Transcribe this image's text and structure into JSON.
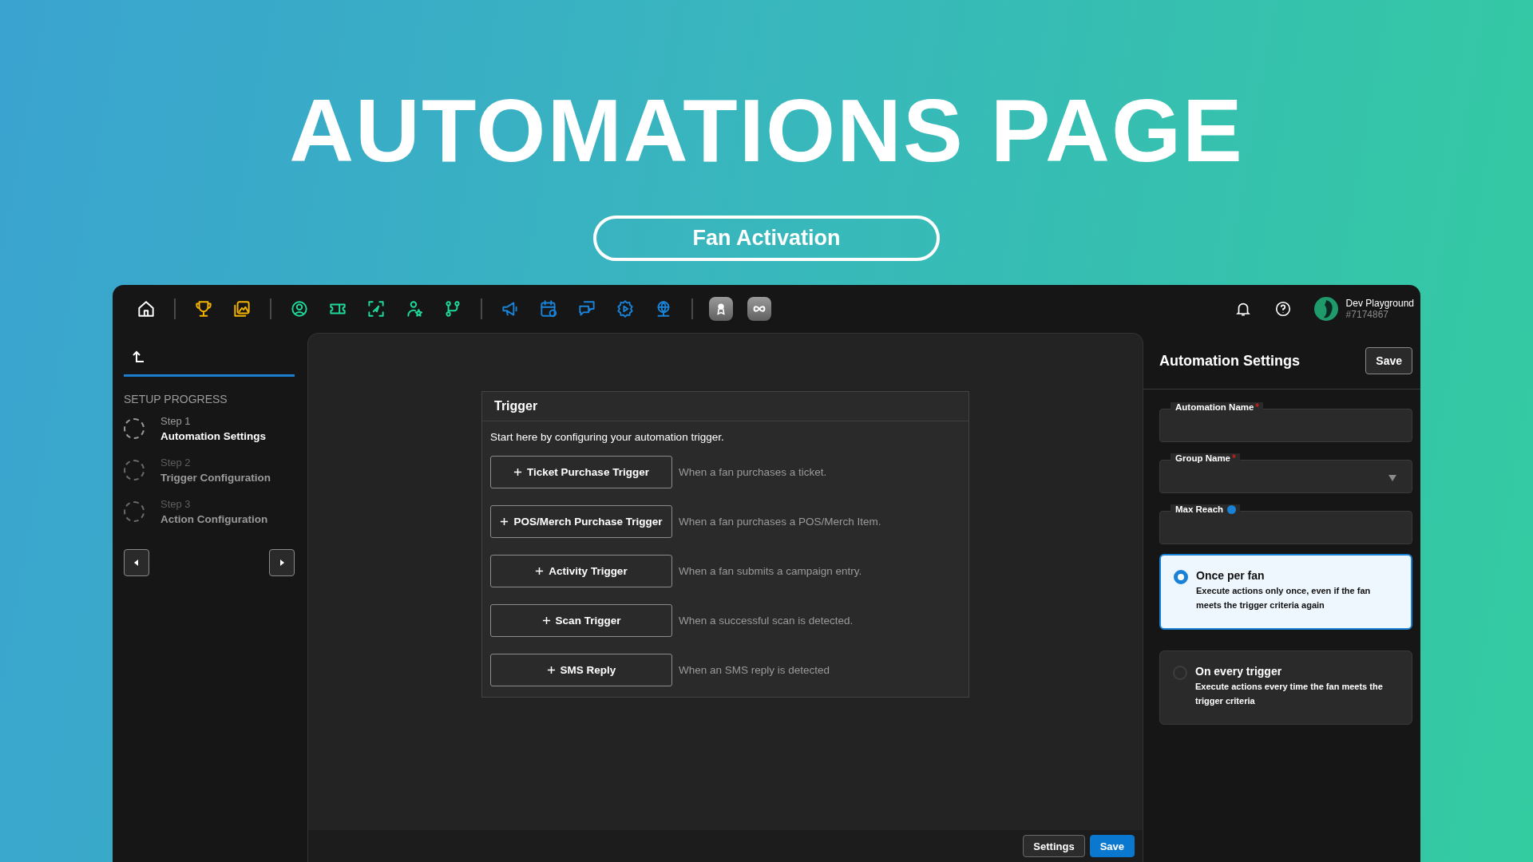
{
  "banner": {
    "title": "AUTOMATIONS PAGE",
    "subtitle": "Fan Activation"
  },
  "top_bar": {
    "account_name": "Dev Playground",
    "account_id": "#7174867"
  },
  "sidebar": {
    "heading": "SETUP PROGRESS",
    "steps": [
      {
        "label": "Step 1",
        "name": "Automation Settings",
        "active": true
      },
      {
        "label": "Step 2",
        "name": "Trigger Configuration",
        "active": false
      },
      {
        "label": "Step 3",
        "name": "Action Configuration",
        "active": false
      }
    ]
  },
  "trigger_card": {
    "title": "Trigger",
    "intro": "Start here by configuring your automation trigger.",
    "triggers": [
      {
        "label": "Ticket Purchase Trigger",
        "description": "When a fan purchases a ticket."
      },
      {
        "label": "POS/Merch Purchase Trigger",
        "description": "When a fan purchases a POS/Merch Item."
      },
      {
        "label": "Activity Trigger",
        "description": "When a fan submits a campaign entry."
      },
      {
        "label": "Scan Trigger",
        "description": "When a successful scan is detected."
      },
      {
        "label": "SMS Reply",
        "description": "When an SMS reply is detected"
      }
    ]
  },
  "footer_buttons": [
    {
      "label": "Settings",
      "kind": "secondary"
    },
    {
      "label": "Save",
      "kind": "primary"
    }
  ],
  "settings_panel": {
    "title": "Automation Settings",
    "save_label": "Save",
    "fields": [
      {
        "label": "Automation Name",
        "kind": "text",
        "required": true,
        "info": false
      },
      {
        "label": "Group Name",
        "kind": "select",
        "required": true,
        "info": false
      },
      {
        "label": "Max Reach",
        "kind": "text",
        "required": false,
        "info": true
      }
    ],
    "options": [
      {
        "title": "Once per fan",
        "description": "Execute actions only once, even if the fan meets the trigger criteria again",
        "selected": true
      },
      {
        "title": "On every trigger",
        "description": "Execute actions every time the fan meets the trigger criteria",
        "selected": false
      }
    ]
  }
}
